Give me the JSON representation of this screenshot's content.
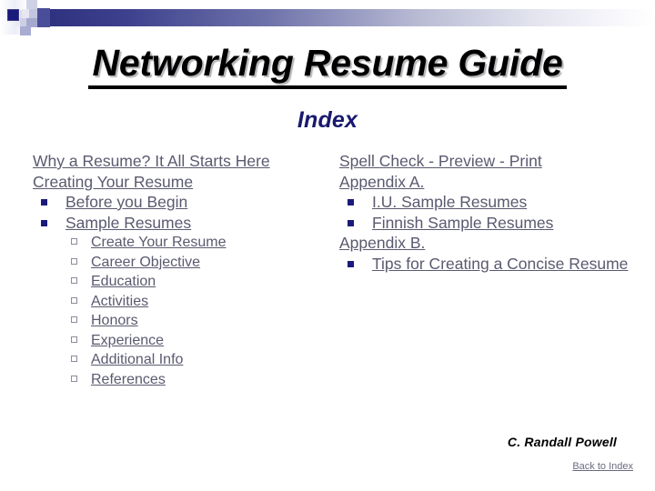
{
  "slide": {
    "title": "Networking Resume Guide",
    "subtitle": "Index",
    "author": "C. Randall Powell",
    "back_link": "Back to Index",
    "colors": {
      "background": "#ffffff",
      "title_text": "#000000",
      "subtitle_text": "#191970",
      "link_text": "#5a5a70",
      "bullet_filled": "#1a1a7a",
      "bullet_hollow_border": "#8b8b9c",
      "header_bar_start": "#2b2f7d",
      "header_bar_end": "#ffffff"
    }
  },
  "left_column": {
    "items": [
      {
        "label": "Why a Resume? It All Starts Here",
        "level": 0,
        "bullet": "none"
      },
      {
        "label": "Creating Your Resume",
        "level": 0,
        "bullet": "none"
      },
      {
        "label": "Before you Begin",
        "level": 1,
        "bullet": "filled-square"
      },
      {
        "label": "Sample Resumes",
        "level": 1,
        "bullet": "filled-square"
      },
      {
        "label": "Create Your Resume",
        "level": 2,
        "bullet": "hollow-square"
      },
      {
        "label": "Career Objective",
        "level": 2,
        "bullet": "hollow-square"
      },
      {
        "label": "Education",
        "level": 2,
        "bullet": "hollow-square"
      },
      {
        "label": "Activities",
        "level": 2,
        "bullet": "hollow-square"
      },
      {
        "label": "Honors",
        "level": 2,
        "bullet": "hollow-square"
      },
      {
        "label": "Experience",
        "level": 2,
        "bullet": "hollow-square"
      },
      {
        "label": "Additional Info",
        "level": 2,
        "bullet": "hollow-square"
      },
      {
        "label": "References",
        "level": 2,
        "bullet": "hollow-square"
      }
    ]
  },
  "right_column": {
    "items": [
      {
        "label": "Spell Check - Preview - Print",
        "level": 0,
        "bullet": "none"
      },
      {
        "label": "Appendix A.",
        "level": 0,
        "bullet": "none"
      },
      {
        "label": "I.U. Sample Resumes",
        "level": 1,
        "bullet": "filled-square"
      },
      {
        "label": "Finnish Sample Resumes",
        "level": 1,
        "bullet": "filled-square"
      },
      {
        "label": "Appendix B.",
        "level": 0,
        "bullet": "none"
      },
      {
        "label": "Tips for Creating a Concise Resume",
        "level": 1,
        "bullet": "filled-square"
      }
    ]
  }
}
